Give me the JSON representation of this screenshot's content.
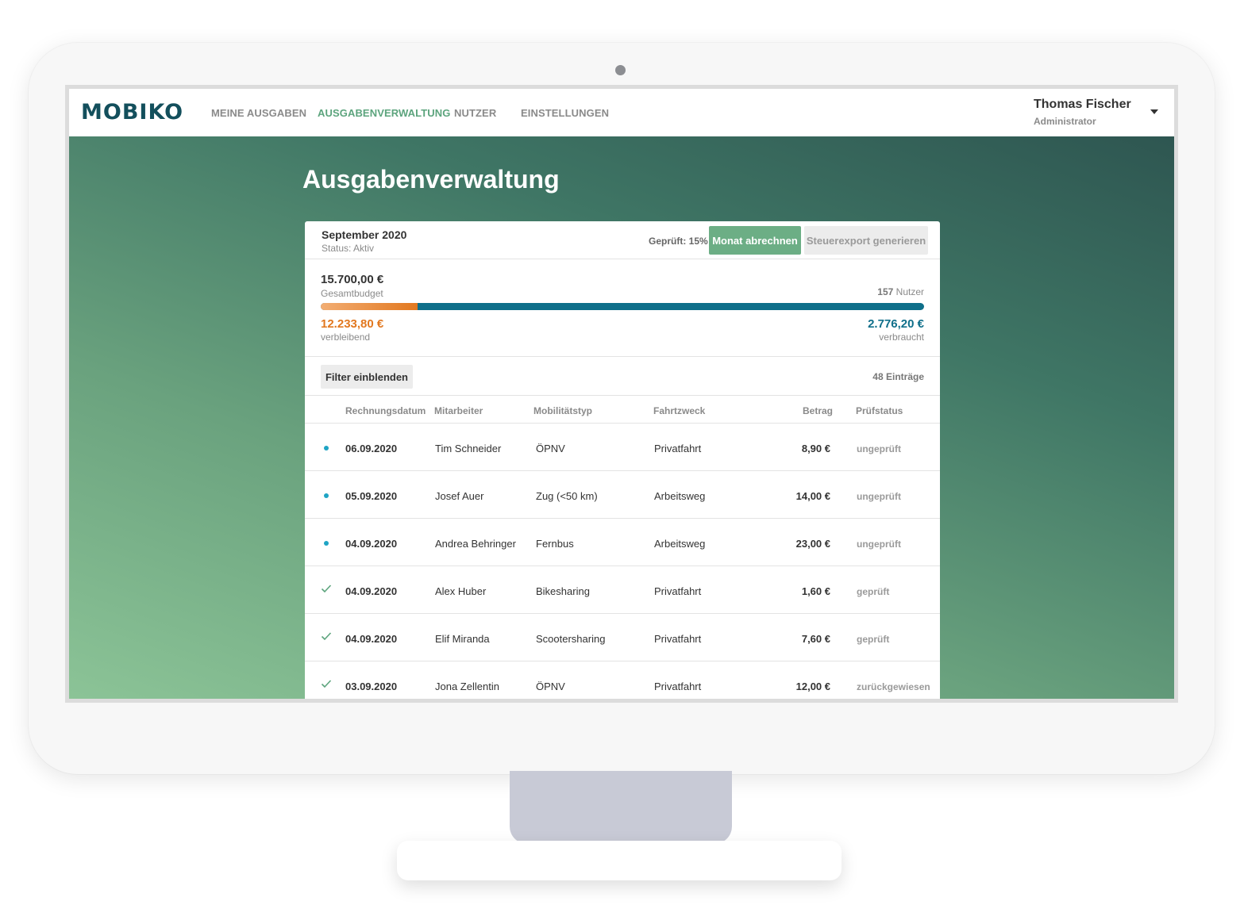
{
  "app": {
    "logo": "MOBIKO",
    "nav": [
      {
        "label": "MEINE AUSGABEN",
        "active": false
      },
      {
        "label": "AUSGABENVERWALTUNG",
        "active": true
      },
      {
        "label": "NUTZER",
        "active": false
      },
      {
        "label": "EINSTELLUNGEN",
        "active": false
      }
    ],
    "user": {
      "name": "Thomas Fischer",
      "role": "Administrator"
    }
  },
  "page": {
    "title": "Ausgabenverwaltung"
  },
  "period": {
    "month": "September 2020",
    "status": "Status: Aktiv",
    "checked": "Geprüft: 15%",
    "primary_button": "Monat abrechnen",
    "secondary_button": "Steuerexport generieren"
  },
  "budget": {
    "total": "15.700,00 €",
    "total_label": "Gesamtbudget",
    "users_count": "157",
    "users_label": "Nutzer",
    "remaining": "12.233,80 €",
    "remaining_label": "verbleibend",
    "spent": "2.776,20 €",
    "spent_label": "verbraucht",
    "remaining_fraction_shown": 0.16,
    "colors": {
      "remaining": "#e2781f",
      "spent": "#0f6f8a"
    }
  },
  "filter": {
    "button": "Filter einblenden",
    "entries": "48 Einträge"
  },
  "table": {
    "headers": {
      "date": "Rechnungsdatum",
      "employee": "Mitarbeiter",
      "type": "Mobilitätstyp",
      "purpose": "Fahrtzweck",
      "amount": "Betrag",
      "status": "Prüfstatus"
    },
    "rows": [
      {
        "marker": "dot-icon",
        "date": "06.09.2020",
        "employee": "Tim Schneider",
        "type": "ÖPNV",
        "purpose": "Privatfahrt",
        "amount": "8,90 €",
        "status": "ungeprüft"
      },
      {
        "marker": "dot-icon",
        "date": "05.09.2020",
        "employee": "Josef Auer",
        "type": "Zug (<50 km)",
        "purpose": "Arbeitsweg",
        "amount": "14,00 €",
        "status": "ungeprüft"
      },
      {
        "marker": "dot-icon",
        "date": "04.09.2020",
        "employee": "Andrea Behringer",
        "type": "Fernbus",
        "purpose": "Arbeitsweg",
        "amount": "23,00 €",
        "status": "ungeprüft"
      },
      {
        "marker": "check-icon",
        "date": "04.09.2020",
        "employee": "Alex Huber",
        "type": "Bikesharing",
        "purpose": "Privatfahrt",
        "amount": "1,60 €",
        "status": "geprüft"
      },
      {
        "marker": "check-icon",
        "date": "04.09.2020",
        "employee": "Elif Miranda",
        "type": "Scootersharing",
        "purpose": "Privatfahrt",
        "amount": "7,60 €",
        "status": "geprüft"
      },
      {
        "marker": "check-icon",
        "date": "03.09.2020",
        "employee": "Jona Zellentin",
        "type": "ÖPNV",
        "purpose": "Privatfahrt",
        "amount": "12,00 €",
        "status": "zurückgewiesen"
      }
    ]
  }
}
